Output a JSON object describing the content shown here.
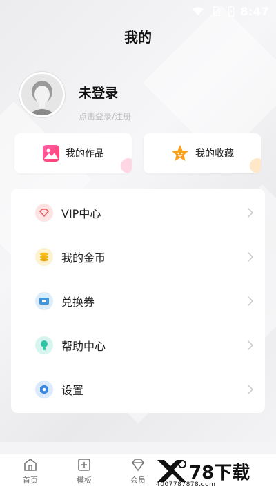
{
  "status": {
    "time": "8:47"
  },
  "header": {
    "title": "我的"
  },
  "profile": {
    "name": "未登录",
    "hint": "点击登录/注册"
  },
  "quick": [
    {
      "label": "我的作品",
      "icon": "gallery-icon"
    },
    {
      "label": "我的收藏",
      "icon": "star-icon"
    }
  ],
  "menu": [
    {
      "label": "VIP中心",
      "icon": "diamond-icon",
      "color": "#f07a7a"
    },
    {
      "label": "我的金币",
      "icon": "coins-icon",
      "color": "#f1c232"
    },
    {
      "label": "兑换券",
      "icon": "coupon-icon",
      "color": "#4aa3e6"
    },
    {
      "label": "帮助中心",
      "icon": "bulb-icon",
      "color": "#3bc9b0"
    },
    {
      "label": "设置",
      "icon": "settings-icon",
      "color": "#3f8ee0"
    }
  ],
  "tabs": [
    {
      "label": "首页",
      "icon": "home-icon"
    },
    {
      "label": "模板",
      "icon": "template-icon"
    },
    {
      "label": "会员",
      "icon": "diamond-outline-icon"
    }
  ],
  "watermark": {
    "text": "78下载",
    "sub": "4007787878.com"
  }
}
